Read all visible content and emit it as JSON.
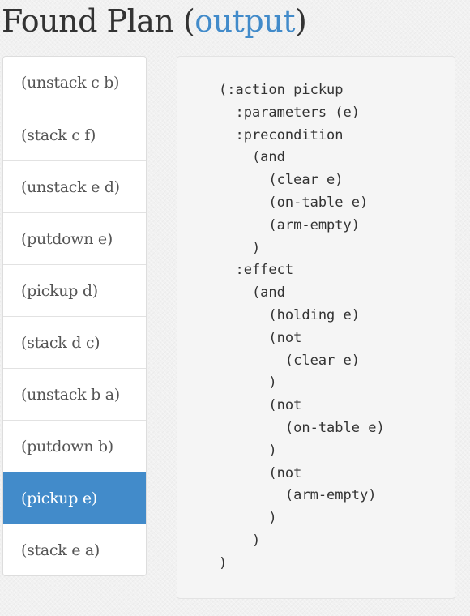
{
  "header": {
    "title": "Found Plan",
    "paren_open": " (",
    "link_label": "output",
    "paren_close": ")"
  },
  "plan": {
    "steps": [
      "(unstack c b)",
      "(stack c f)",
      "(unstack e d)",
      "(putdown e)",
      "(pickup d)",
      "(stack d c)",
      "(unstack b a)",
      "(putdown b)",
      "(pickup e)",
      "(stack e a)"
    ],
    "selected_step": "(pickup e)"
  },
  "action_definition": {
    "code": "(:action pickup\n  :parameters (e)\n  :precondition\n    (and\n      (clear e)\n      (on-table e)\n      (arm-empty)\n    )\n  :effect\n    (and\n      (holding e)\n      (not\n        (clear e)\n      )\n      (not\n        (on-table e)\n      )\n      (not\n        (arm-empty)\n      )\n    )\n)"
  },
  "colors": {
    "accent": "#428bca",
    "text": "#333333",
    "page_background": "#f1f1f1"
  }
}
